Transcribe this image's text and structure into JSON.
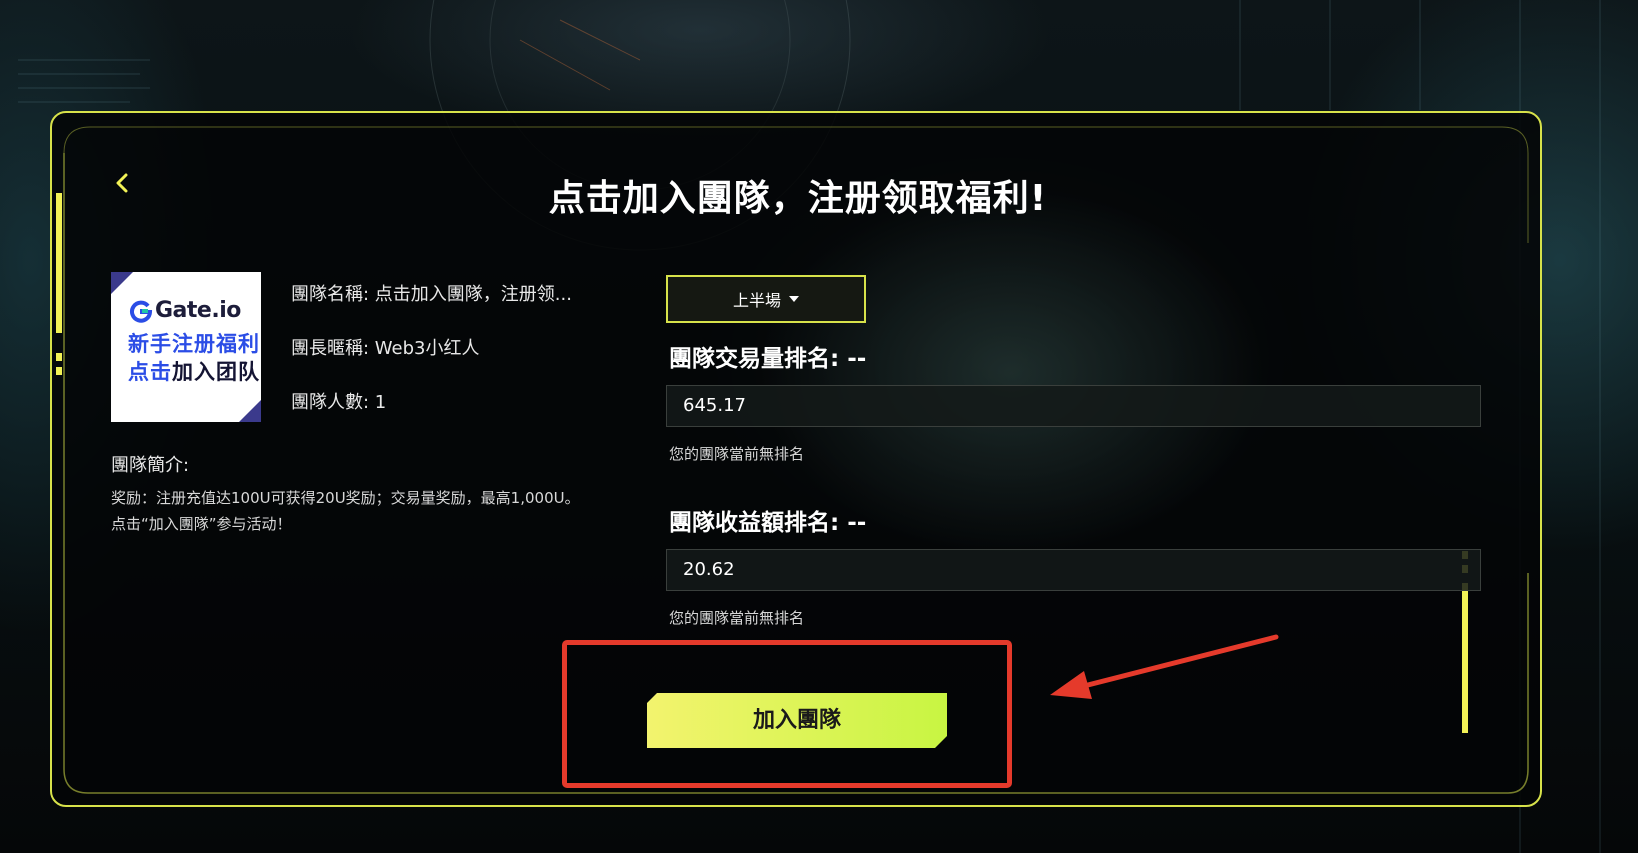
{
  "header": {
    "title": "点击加入團隊，注册领取福利!"
  },
  "logo": {
    "brand": "Gate.io",
    "line1": "新手注册福利",
    "line2_a": "点击",
    "line2_b": "加入团队"
  },
  "team": {
    "name_label": "團隊名稱",
    "name_value": "点击加入團隊，注册领...",
    "leader_label": "團長暱稱",
    "leader_value": "Web3小红人",
    "members_label": "團隊人數",
    "members_value": "1",
    "intro_title": "團隊簡介:",
    "intro_text": "奖励：注册充值达100U可获得20U奖励；交易量奖励，最高1,000U。点击“加入團隊”参与活动！"
  },
  "session_select": {
    "value": "上半場"
  },
  "rankings": [
    {
      "title": "團隊交易量排名: --",
      "value": "645.17",
      "note": "您的團隊當前無排名"
    },
    {
      "title": "團隊收益額排名: --",
      "value": "20.62",
      "note": "您的團隊當前無排名"
    }
  ],
  "actions": {
    "join_label": "加入團隊"
  },
  "icons": {
    "back": "chevron-left-icon",
    "dropdown": "caret-down-icon",
    "brand": "gate-logo-icon"
  },
  "colors": {
    "accent": "#d7e24a",
    "button_start": "#f3f36e",
    "button_end": "#c8f542",
    "annotation": "#e53a2b",
    "background": "#07090b"
  }
}
